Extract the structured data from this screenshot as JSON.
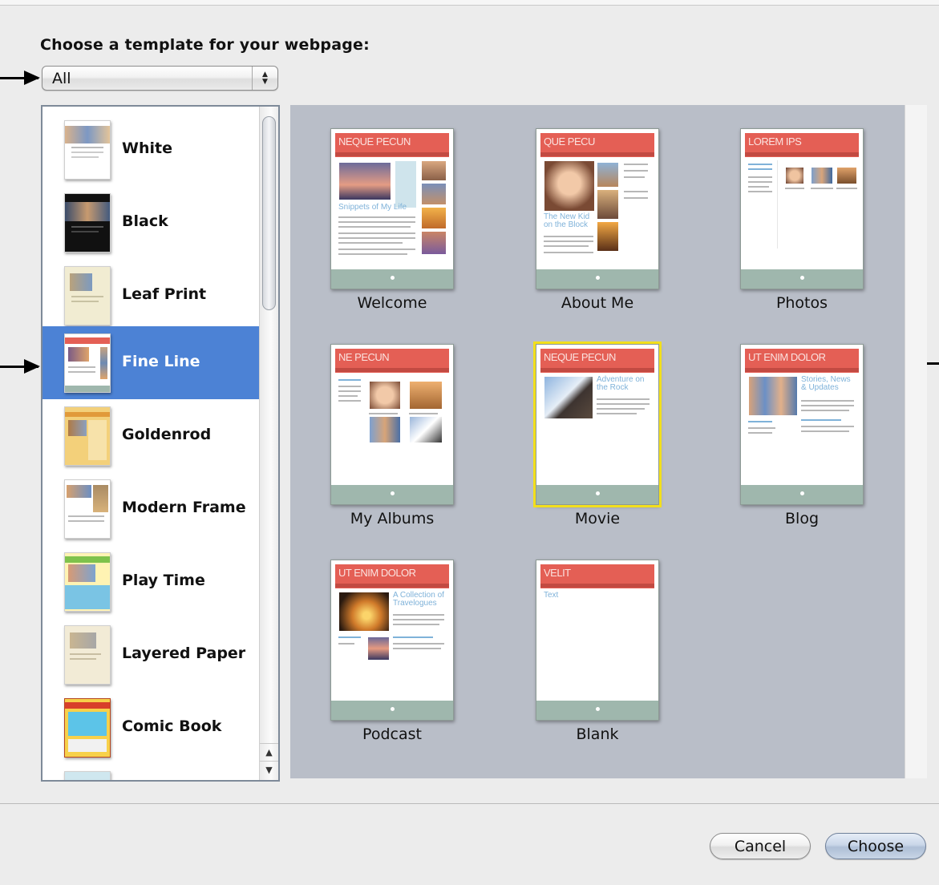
{
  "dialog": {
    "prompt": "Choose a template for your webpage:",
    "filter": {
      "selected": "All"
    }
  },
  "categories": [
    {
      "label": "White",
      "selected": false
    },
    {
      "label": "Black",
      "selected": false
    },
    {
      "label": "Leaf Print",
      "selected": false
    },
    {
      "label": "Fine Line",
      "selected": true
    },
    {
      "label": "Goldenrod",
      "selected": false
    },
    {
      "label": "Modern Frame",
      "selected": false
    },
    {
      "label": "Play Time",
      "selected": false
    },
    {
      "label": "Layered Paper",
      "selected": false
    },
    {
      "label": "Comic Book",
      "selected": false
    }
  ],
  "templates": [
    {
      "label": "Welcome",
      "header": "NEQUE PECUN",
      "subhead": "Snippets of My Life",
      "selected": false
    },
    {
      "label": "About Me",
      "header": "QUE PECU",
      "subhead": "The New Kid on the Block",
      "selected": false
    },
    {
      "label": "Photos",
      "header": "LOREM IPS",
      "subhead": "",
      "selected": false
    },
    {
      "label": "My Albums",
      "header": "NE PECUN",
      "subhead": "",
      "selected": false
    },
    {
      "label": "Movie",
      "header": "NEQUE PECUN",
      "subhead": "Adventure on the Rock",
      "selected": true
    },
    {
      "label": "Blog",
      "header": "UT ENIM DOLOR",
      "subhead": "Stories, News & Updates",
      "selected": false
    },
    {
      "label": "Podcast",
      "header": "UT ENIM DOLOR",
      "subhead": "A Collection of Travelogues",
      "selected": false
    },
    {
      "label": "Blank",
      "header": "VELIT",
      "subhead": "Text",
      "selected": false
    }
  ],
  "buttons": {
    "cancel": "Cancel",
    "choose": "Choose"
  },
  "colors": {
    "selection": "#4c82d5",
    "template_header": "#e45f55",
    "template_footer": "#9fb7ad",
    "grid_background": "#b9bec8",
    "highlight": "#f2df1c"
  }
}
